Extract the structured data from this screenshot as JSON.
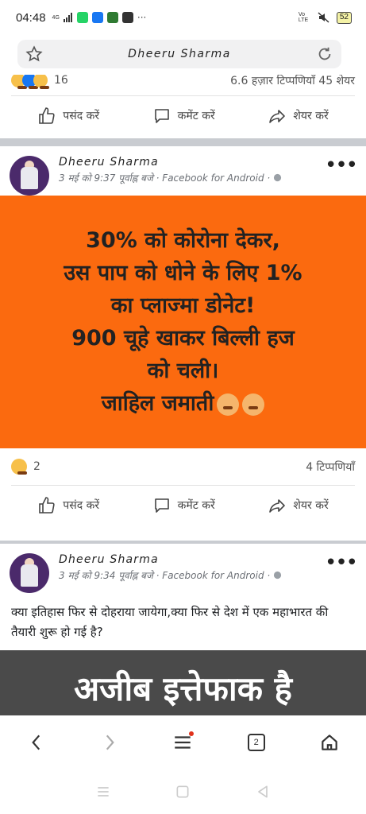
{
  "status_bar": {
    "time": "04:48",
    "network_label": "4G",
    "right_network": "Vo LTE",
    "battery": "52"
  },
  "browser": {
    "page_title": "Dheeru Sharma",
    "tab_count": "2"
  },
  "feed": {
    "top_post": {
      "reactions_count": "16",
      "stats_right": "6.6 हज़ार टिप्पणियाँ  45 शेयर"
    },
    "post1": {
      "author": "Dheeru Sharma",
      "meta": "3 मई को 9:37 पूर्वाह्न बजे · Facebook for Android ·",
      "image_lines": [
        "30% को कोरोना देकर,",
        "उस पाप को धोने के लिए 1%",
        "का प्लाज्मा डोनेट!",
        "900 चूहे खाकर बिल्ली हज",
        "को चली।",
        "जाहिल जमाती"
      ],
      "reactions_count": "2",
      "comments": "4 टिप्पणियाँ"
    },
    "post2": {
      "author": "Dheeru Sharma",
      "meta": "3 मई को 9:34 पूर्वाह्न बजे · Facebook for Android ·",
      "text": "क्या इतिहास फिर से दोहराया जायेगा,क्या फिर से देश में एक महाभारत की तैयारी शुरू हो गई है?",
      "image_text": "अजीब इत्तेफाक है"
    },
    "actions": {
      "like": "पसंद करें",
      "comment": "कमेंट करें",
      "share": "शेयर करें"
    }
  },
  "colors": {
    "post_image_bg": "#fb6a0f",
    "feed_bg": "#c9ccd1",
    "notification_dot": "#e0321c"
  }
}
